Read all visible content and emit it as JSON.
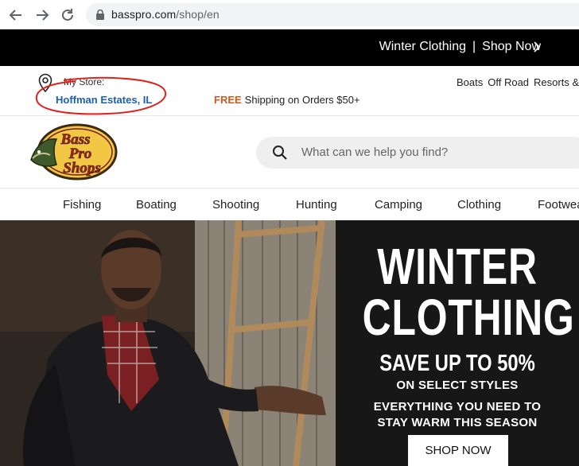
{
  "browser": {
    "url_domain": "basspro.com",
    "url_path": "/shop/en"
  },
  "promo": {
    "title": "Winter Clothing",
    "separator": "|",
    "cta": "Shop Now"
  },
  "store": {
    "label": "My Store:",
    "name": "Hoffman Estates, IL"
  },
  "shipping": {
    "free": "FREE",
    "text": "Shipping on Orders $50+"
  },
  "top_links": [
    "Boats",
    "Off Road",
    "Resorts &"
  ],
  "logo": {
    "alt": "Bass Pro Shops",
    "line1": "Bass",
    "line2": "Pro",
    "line3": "Shops"
  },
  "search": {
    "placeholder": "What can we help you find?"
  },
  "categories": [
    "Fishing",
    "Boating",
    "Shooting",
    "Hunting",
    "Camping",
    "Clothing",
    "Footwea"
  ],
  "hero": {
    "line1": "WINTER",
    "line2": "CLOTHING",
    "save": "SAVE UP TO 50%",
    "select": "ON SELECT STYLES",
    "every1": "EVERYTHING YOU NEED TO",
    "every2": "STAY WARM THIS SEASON",
    "button": "SHOP NOW"
  },
  "colors": {
    "promo_bg": "#000000",
    "store_link": "#1a5fb4",
    "free": "#d4581c",
    "annotation": "#e0201a",
    "hero_bg": "#171717"
  }
}
